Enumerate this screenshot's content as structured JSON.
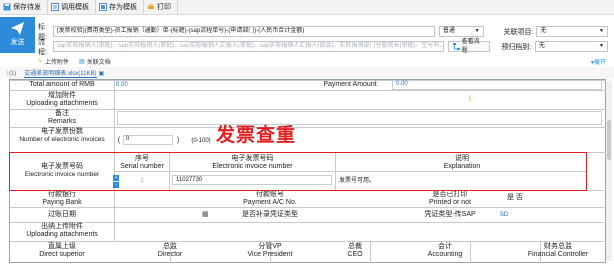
{
  "toolbar": {
    "save_draft": "保存待发",
    "call_template": "调用模板",
    "save_template": "存为模板",
    "print": "打印"
  },
  "send": {
    "label": "发送"
  },
  "header": {
    "title_label": "标题:",
    "title_value": "(发票校验)(费用类型)-员工报销（通勤）单-(标题)-(sap流程单号)-(申请部门)-(人民币合计金额)",
    "priority_value": "普通",
    "related_label": "关联项目:",
    "related_value": "无",
    "flow_label": "流程:",
    "flow_placeholder": "sap实际报销人(审批)、sap实际报销人(审批)、sap实际报销人汇报人(审批)、sap实际报销人汇报人(知会)、实际报销部门分管院长(审批)、空号吗、空号",
    "view_flow_button": "查看流程",
    "archive_label": "预归档到:",
    "archive_value": "无"
  },
  "attachments": {
    "upload_label": "上传附件",
    "related_doc_label": "关联文档",
    "expand_label": "展开",
    "count": "(1)",
    "file_name": "交通差旅明细表.xlsx(11KB)"
  },
  "form": {
    "total_cn": "Total amount of RMB",
    "payment_amount_label": "Payment Amount",
    "payment_amount_value": "0.00",
    "small_value": "0.00",
    "attach_cn": "增加附件",
    "attach_en": "Uploading attachments",
    "remarks_cn": "备注",
    "remarks_en": "Remarks",
    "invoice_count_cn": "电子发票份数",
    "invoice_count_en": "Number of electronic invoices",
    "invoice_count_value": "0",
    "invoice_count_range": "(0-100)",
    "invoice_no_cn": "电子发票号码",
    "invoice_no_en": "Electronic invoice number",
    "col_serial_cn": "序号",
    "col_serial_en": "Serial number",
    "col_number_cn": "电子发票号码",
    "col_number_en": "Electronic invoice number",
    "col_expl_cn": "说明",
    "col_expl_en": "Explanation",
    "row_serial": "1",
    "row_number": "11027730",
    "row_expl": "发票号可用。",
    "bank_cn": "付款银行",
    "bank_en": "Paying Bank",
    "account_cn": "付款账号",
    "account_en": "Payment A/C No.",
    "printed_cn": "是否已打印",
    "printed_en": "Printed or not",
    "printed_value": "是 否",
    "voucher_cn": "过账日期",
    "voucher_type_cn": "是否补录凭证类型",
    "sap_cn": "凭证类型-传SAP",
    "sap_value": "SD",
    "attach2_cn": "出纳上传附件",
    "attach2_en": "Uploading attachments",
    "approvers": [
      {
        "cn": "直属上级",
        "en": "Direct superior"
      },
      {
        "cn": "总监",
        "en": "Director"
      },
      {
        "cn": "分管VP",
        "en": "Vice President"
      },
      {
        "cn": "总裁",
        "en": "CEO"
      },
      {
        "cn": "会计",
        "en": "Accounting"
      },
      {
        "cn": "财务总监",
        "en": "Financial Controller"
      }
    ]
  },
  "annotation": {
    "text": "发票查重"
  },
  "colors": {
    "accent": "#2d8ad9",
    "annotation": "#e02020"
  }
}
